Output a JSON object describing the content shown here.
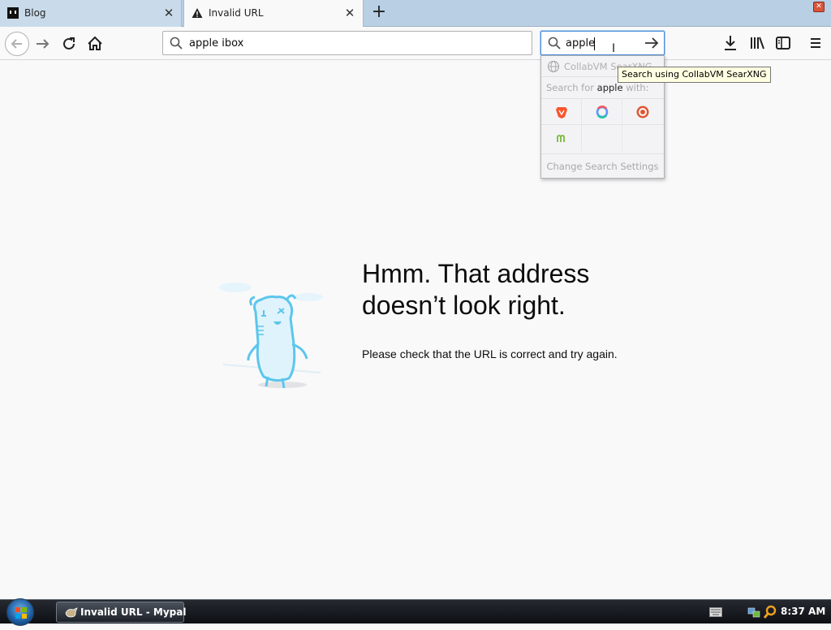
{
  "tabs": [
    {
      "label": "Blog",
      "icon": "blog-favicon",
      "active": false
    },
    {
      "label": "Invalid URL",
      "icon": "warning-icon",
      "active": true
    }
  ],
  "urlbar": {
    "value": "apple ibox"
  },
  "searchbar": {
    "value": "apple"
  },
  "search_popup": {
    "engine_name": "CollabVM SearXNG",
    "search_for_prefix": "Search for",
    "search_term": "apple",
    "search_for_suffix": "with:",
    "engines": [
      "brave-icon",
      "qwant-icon",
      "duckduckgo-icon",
      "mojeek-icon"
    ],
    "settings_label": "Change Search Settings"
  },
  "tooltip": "Search using CollabVM SearXNG",
  "error_page": {
    "headline_line1": "Hmm. That address",
    "headline_line2": "doesn’t look right.",
    "message": "Please check that the URL is correct and try again."
  },
  "taskbar": {
    "window_label": "Invalid URL - Mypal",
    "clock": "8:37 AM"
  },
  "colors": {
    "accent": "#4a90d9",
    "tooltip_bg": "#ffffe1",
    "tabbar": "#b8cfe4"
  }
}
